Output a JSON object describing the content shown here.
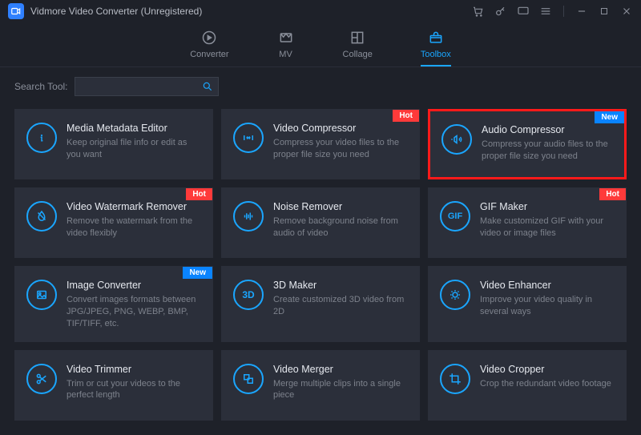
{
  "app": {
    "title": "Vidmore Video Converter (Unregistered)"
  },
  "nav": {
    "converter": "Converter",
    "mv": "MV",
    "collage": "Collage",
    "toolbox": "Toolbox"
  },
  "search": {
    "label": "Search Tool:",
    "placeholder": ""
  },
  "badges": {
    "hot": "Hot",
    "new": "New"
  },
  "tools": {
    "metadata": {
      "title": "Media Metadata Editor",
      "desc": "Keep original file info or edit as you want"
    },
    "vcompress": {
      "title": "Video Compressor",
      "desc": "Compress your video files to the proper file size you need"
    },
    "acompress": {
      "title": "Audio Compressor",
      "desc": "Compress your audio files to the proper file size you need"
    },
    "watermark": {
      "title": "Video Watermark Remover",
      "desc": "Remove the watermark from the video flexibly"
    },
    "noise": {
      "title": "Noise Remover",
      "desc": "Remove background noise from audio of video"
    },
    "gif": {
      "title": "GIF Maker",
      "desc": "Make customized GIF with your video or image files"
    },
    "imgconv": {
      "title": "Image Converter",
      "desc": "Convert images formats between JPG/JPEG, PNG, WEBP, BMP, TIF/TIFF, etc."
    },
    "threed": {
      "title": "3D Maker",
      "desc": "Create customized 3D video from 2D"
    },
    "enhance": {
      "title": "Video Enhancer",
      "desc": "Improve your video quality in several ways"
    },
    "trim": {
      "title": "Video Trimmer",
      "desc": "Trim or cut your videos to the perfect length"
    },
    "merge": {
      "title": "Video Merger",
      "desc": "Merge multiple clips into a single piece"
    },
    "crop": {
      "title": "Video Cropper",
      "desc": "Crop the redundant video footage"
    }
  }
}
